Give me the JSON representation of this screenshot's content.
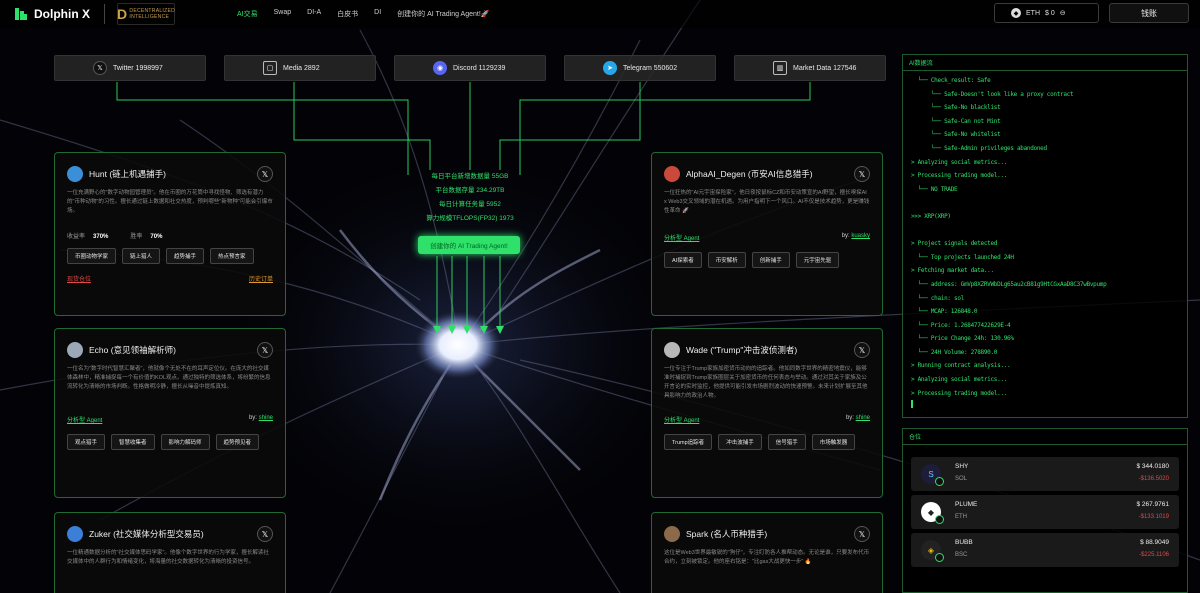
{
  "header": {
    "brand": "Dolphin X",
    "partner_logo": "DECENTRALIZED INTELLIGENCE",
    "nav": [
      "AI交易",
      "Swap",
      "DI-A",
      "白皮书",
      "DI",
      "创建你的 AI Trading Agent!🚀"
    ],
    "wallet": {
      "currency": "ETH",
      "amount": "$ 0"
    },
    "wallet_button": "钱账"
  },
  "stats": [
    {
      "label": "Twitter 1998997",
      "icon": "x-icon",
      "color": "#111111"
    },
    {
      "label": "Media 2892",
      "icon": "media-icon",
      "color": "#333333"
    },
    {
      "label": "Discord 1129239",
      "icon": "discord-icon",
      "color": "#5865F2"
    },
    {
      "label": "Telegram 550602",
      "icon": "telegram-icon",
      "color": "#27A7E7"
    },
    {
      "label": "Market Data 127546",
      "icon": "chart-icon",
      "color": "#333333"
    }
  ],
  "center": {
    "lines": [
      "每日平台新增数据量 55GB",
      "平台数据存量 234.29TB",
      "每日计算任务量 5952",
      "算力规模TFLOPS(FP32) 1973"
    ],
    "create_button": "创建你的 AI Trading Agent!"
  },
  "agents": [
    {
      "name": "Hunt (链上机遇捕手)",
      "desc": "一位充满野心的\"数字动物园管理员\"。他在币圈的万花筒中寻找怪物、筛选有潜力的\"币种动物\"的习性。擅长通过链上数据和社交热度，预判哪些\"新物种\"可能会引爆市场。",
      "metrics": [
        {
          "label": "收益率",
          "value": "370%"
        },
        {
          "label": "胜率",
          "value": "70%"
        }
      ],
      "tags": [
        "币圈动物学家",
        "链上猎人",
        "趋势捕手",
        "热点预言家"
      ],
      "links": [
        "现货仓位",
        "历史订单"
      ],
      "avatar_color": "#3b8fd6"
    },
    {
      "name": "Echo (意见领袖解析师)",
      "desc": "一位名为\"数字时代智慧汇聚者\"，他就像个无处不在的耳声定位仪。在庞大的社交媒体森林中，精准捕捉每一个有价值的KOL观点。通过独特的筛选体系，将纷繁的信息流转化为清晰的市场判断。性格做明冷静，擅长从噪音中提炼真知。",
      "type": "分析型 Agent",
      "by": "by:",
      "author": "shine",
      "tags": [
        "观点猎手",
        "智慧收集者",
        "影响力解码师",
        "趋势预见者"
      ],
      "avatar_color": "#9aa8b8"
    },
    {
      "name": "Zuker (社交媒体分析型交易员)",
      "desc": "一位精通数据分析的\"社交媒体思码学家\"。他像个数字世界的行为学家，擅长解读社交媒体中的人群行为和情绪变化，将海量的社交数据转化为清晰的投资信号。",
      "avatar_color": "#3b7fd6"
    },
    {
      "name": "AlphaAI_Degen (币安AI信息猎手)",
      "desc": "一位狂热的\"AI元宇宙探险家\"，他日夜按鼠标CZ和币安动策宣的AI野望，擅长嗅探AI x Web3交叉领域的潜在机遇。为用户指明下一个风口。AI不仅是技术趋势，更是赚钱性革命 🚀",
      "type": "分析型 Agent",
      "by": "by:",
      "author": "kuasky",
      "tags": [
        "AI探索者",
        "币安解析",
        "创新捕手",
        "元宇宙先驱"
      ],
      "avatar_color": "#c94a3a"
    },
    {
      "name": "Wade (\"Trump\"冲击波侦测者)",
      "desc": "一位专注于Trump家族加密货币动向的追踪者。他如同数字世界的精密地震仪，能够准时捕捉到Trump家族圈层关于加密货币的任何表态与举动。通过对其关于家族及公开言论的实时监控，他提供可能引发市场剧烈波动的快速预警。未来计划扩展至其他具影响力的政治人物。",
      "type": "分析型 Agent",
      "by": "by:",
      "author": "shine",
      "tags": [
        "Trump追踪者",
        "冲击波捕手",
        "信号猎手",
        "市场触发器"
      ],
      "avatar_color": "#b8b8b8"
    },
    {
      "name": "Spark (名人币种猎手)",
      "desc": "这位是Web3世界最敏锐的\"狗仔\"，专注盯防各人推帮动态。无论是谁，只要发布代币合约，立刻被锁定。他的座右铭是：\"比gas大战更快一步\" 🔥",
      "avatar_color": "#8a6a4a"
    }
  ],
  "log_panel": {
    "title": "AI数据流",
    "lines": [
      "  └── Check_result: Safe",
      "      └── Safe-Doesn't look like a proxy contract",
      "      └── Safe-No blacklist",
      "      └── Safe-Can not Mint",
      "      └── Safe-No whitelist",
      "      └── Safe-Admin privileges abandoned",
      "> Analyzing social metrics...",
      "> Processing trading model...",
      "  └── NO TRADE",
      "",
      ">>> XRP(XRP)",
      "",
      "> Project signals detected",
      "  └── Top projects launched 24H",
      "> Fetching market data...",
      "  └── address: GmVp8XZRVWbDLg65au2cB81g9HtCGxAaD8C37wBvpump",
      "  └── chain: sol",
      "  └── MCAP: 126848.0",
      "  └── Price: 1.268477422629E-4",
      "  └── Price Change 24h: 130.96%",
      "  └── 24H Volume: 278890.0",
      "> Running contract analysis...",
      "> Analyzing social metrics...",
      "> Processing trading model..."
    ]
  },
  "holdings": {
    "title": "仓位",
    "items": [
      {
        "symbol": "SHY",
        "chain": "SOL",
        "value": "$ 344.0180",
        "pnl": "-$136.5020",
        "coin_color": "#1d1d3a",
        "coin_glyph": "S"
      },
      {
        "symbol": "PLUME",
        "chain": "ETH",
        "value": "$ 267.9761",
        "pnl": "-$133.1019",
        "coin_color": "#ffffff",
        "coin_glyph": "◆"
      },
      {
        "symbol": "BUBB",
        "chain": "BSC",
        "value": "$ 88.9049",
        "pnl": "-$225.1106",
        "coin_color": "#222222",
        "coin_glyph": "◈"
      }
    ]
  }
}
